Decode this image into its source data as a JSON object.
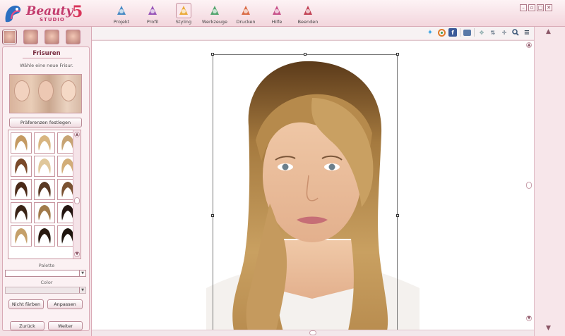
{
  "app": {
    "title_main": "Beauty",
    "title_sub": "STUDIO",
    "title_version": "5"
  },
  "toolbar": {
    "items": [
      {
        "label": "Projekt",
        "icon": "project-icon",
        "color": "#2b7bbd"
      },
      {
        "label": "Profil",
        "icon": "profile-icon",
        "color": "#8a3fb0"
      },
      {
        "label": "Styling",
        "icon": "styling-icon",
        "color": "#e8a11e"
      },
      {
        "label": "Werkzeuge",
        "icon": "tools-icon",
        "color": "#3a9a5b"
      },
      {
        "label": "Drucken",
        "icon": "print-icon",
        "color": "#d5582a"
      },
      {
        "label": "Hilfe",
        "icon": "help-icon",
        "color": "#c0397a"
      },
      {
        "label": "Beenden",
        "icon": "exit-icon",
        "color": "#b8283c"
      }
    ],
    "active": "Styling"
  },
  "sidebar": {
    "panel_title": "Frisuren",
    "panel_subtitle": "Wähle eine neue Frisur.",
    "preferences_button": "Präferenzen festlegen",
    "palette_label": "Palette",
    "color_label": "Color",
    "no_color_button": "Nicht färben",
    "adjust_button": "Anpassen",
    "back_button": "Zurück",
    "next_button": "Weiter",
    "hair_swatches": [
      "#c49a62",
      "#d8b580",
      "#c7a474",
      "#7a4a2a",
      "#e0c79a",
      "#d2ad78",
      "#4a2a18",
      "#5a3a25",
      "#7a5232",
      "#3a2416",
      "#a17a4a",
      "#231510",
      "#c5a06a",
      "#2a1a10",
      "#1e140d"
    ]
  },
  "canvas_toolbar": {
    "icons": [
      "twitter-icon",
      "share-icon",
      "facebook-icon",
      "screen-icon",
      "move-icon",
      "rotate-icon",
      "crosshair-icon",
      "zoom-icon",
      "menu-icon"
    ]
  },
  "window_controls": [
    "minimize",
    "restore",
    "maximize",
    "close"
  ]
}
